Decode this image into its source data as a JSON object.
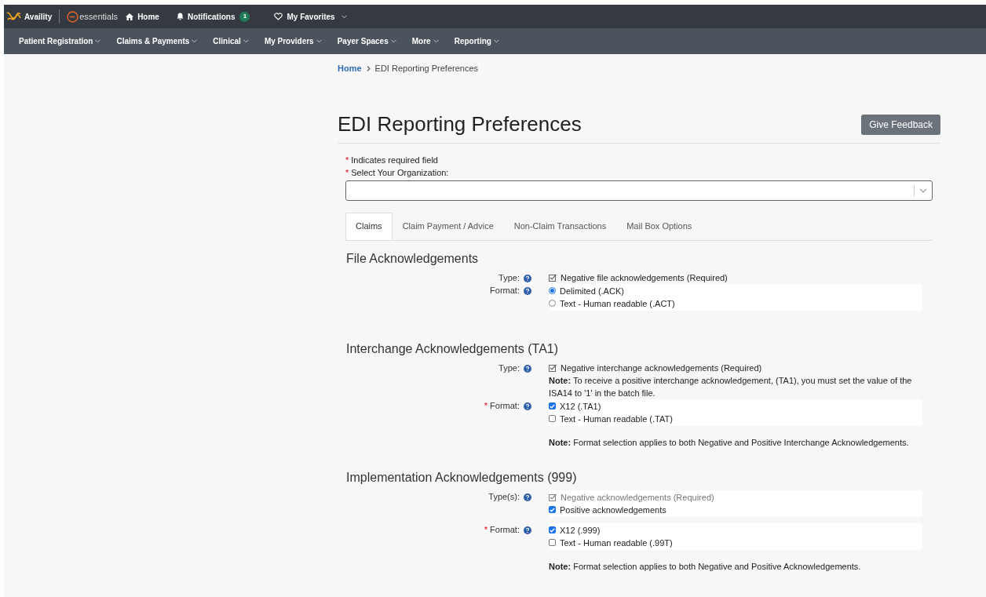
{
  "top_bar": {
    "brand": "Availity",
    "product": "essentials",
    "links": [
      {
        "kind": "home",
        "label": "Home"
      },
      {
        "kind": "notifications",
        "label": "Notifications",
        "badge": "1"
      },
      {
        "kind": "favorites",
        "label": "My Favorites"
      }
    ]
  },
  "main_nav": [
    "Patient Registration",
    "Claims & Payments",
    "Clinical",
    "My Providers",
    "Payer Spaces",
    "More",
    "Reporting"
  ],
  "breadcrumb": {
    "home": "Home",
    "current": "EDI Reporting Preferences"
  },
  "page_title": "EDI Reporting Preferences",
  "feedback_button": "Give Feedback",
  "required_legend": {
    "mark": "*",
    "text": "Indicates required field"
  },
  "organization_field": {
    "required_mark": "*",
    "label": "Select Your Organization:"
  },
  "tabs": [
    {
      "label": "Claims",
      "selected": true
    },
    {
      "label": "Claim Payment / Advice",
      "selected": false
    },
    {
      "label": "Non-Claim Transactions",
      "selected": false
    },
    {
      "label": "Mail Box Options",
      "selected": false
    }
  ],
  "sections": [
    {
      "title": "File Acknowledgements",
      "rows": [
        {
          "label": "Type:",
          "options": [
            {
              "kind": "locked",
              "label": "Negative file acknowledgements (Required)",
              "checked": true,
              "disabled": false
            }
          ]
        },
        {
          "label": "Format:",
          "options": [
            {
              "kind": "radio",
              "label": "Delimited (.ACK)",
              "checked": true
            },
            {
              "kind": "radio",
              "label": "Text - Human readable (.ACT)",
              "checked": false
            }
          ]
        }
      ]
    },
    {
      "title": "Interchange Acknowledgements (TA1)",
      "rows": [
        {
          "label": "Type:",
          "options": [
            {
              "kind": "locked",
              "label": "Negative interchange acknowledgements (Required)",
              "checked": true,
              "disabled": false
            }
          ],
          "note": "**Note:** To receive a positive interchange acknowledgement, (TA1), you must set the value of the ISA14 to '1' in the batch file."
        },
        {
          "required_mark": "*",
          "label": "Format:",
          "options": [
            {
              "kind": "checkbox",
              "label": "X12 (.TA1)",
              "checked": true
            },
            {
              "kind": "checkbox",
              "label": "Text - Human readable (.TAT)",
              "checked": false
            }
          ],
          "note": "**Note:** Format selection applies to both Negative and Positive Interchange Acknowledgements."
        }
      ]
    },
    {
      "title": "Implementation Acknowledgements (999)",
      "rows": [
        {
          "label": "Type(s):",
          "options": [
            {
              "kind": "locked",
              "label": "Negative acknowledgements (Required)",
              "checked": true,
              "disabled": true
            },
            {
              "kind": "checkbox",
              "label": "Positive acknowledgements",
              "checked": true
            }
          ]
        },
        {
          "required_mark": "*",
          "label": "Format:",
          "options": [
            {
              "kind": "checkbox",
              "label": "X12 (.999)",
              "checked": true
            },
            {
              "kind": "checkbox",
              "label": "Text - Human readable (.99T)",
              "checked": false
            }
          ],
          "note": "**Note:** Format selection applies to both Negative and Positive Acknowledgements."
        }
      ]
    }
  ]
}
